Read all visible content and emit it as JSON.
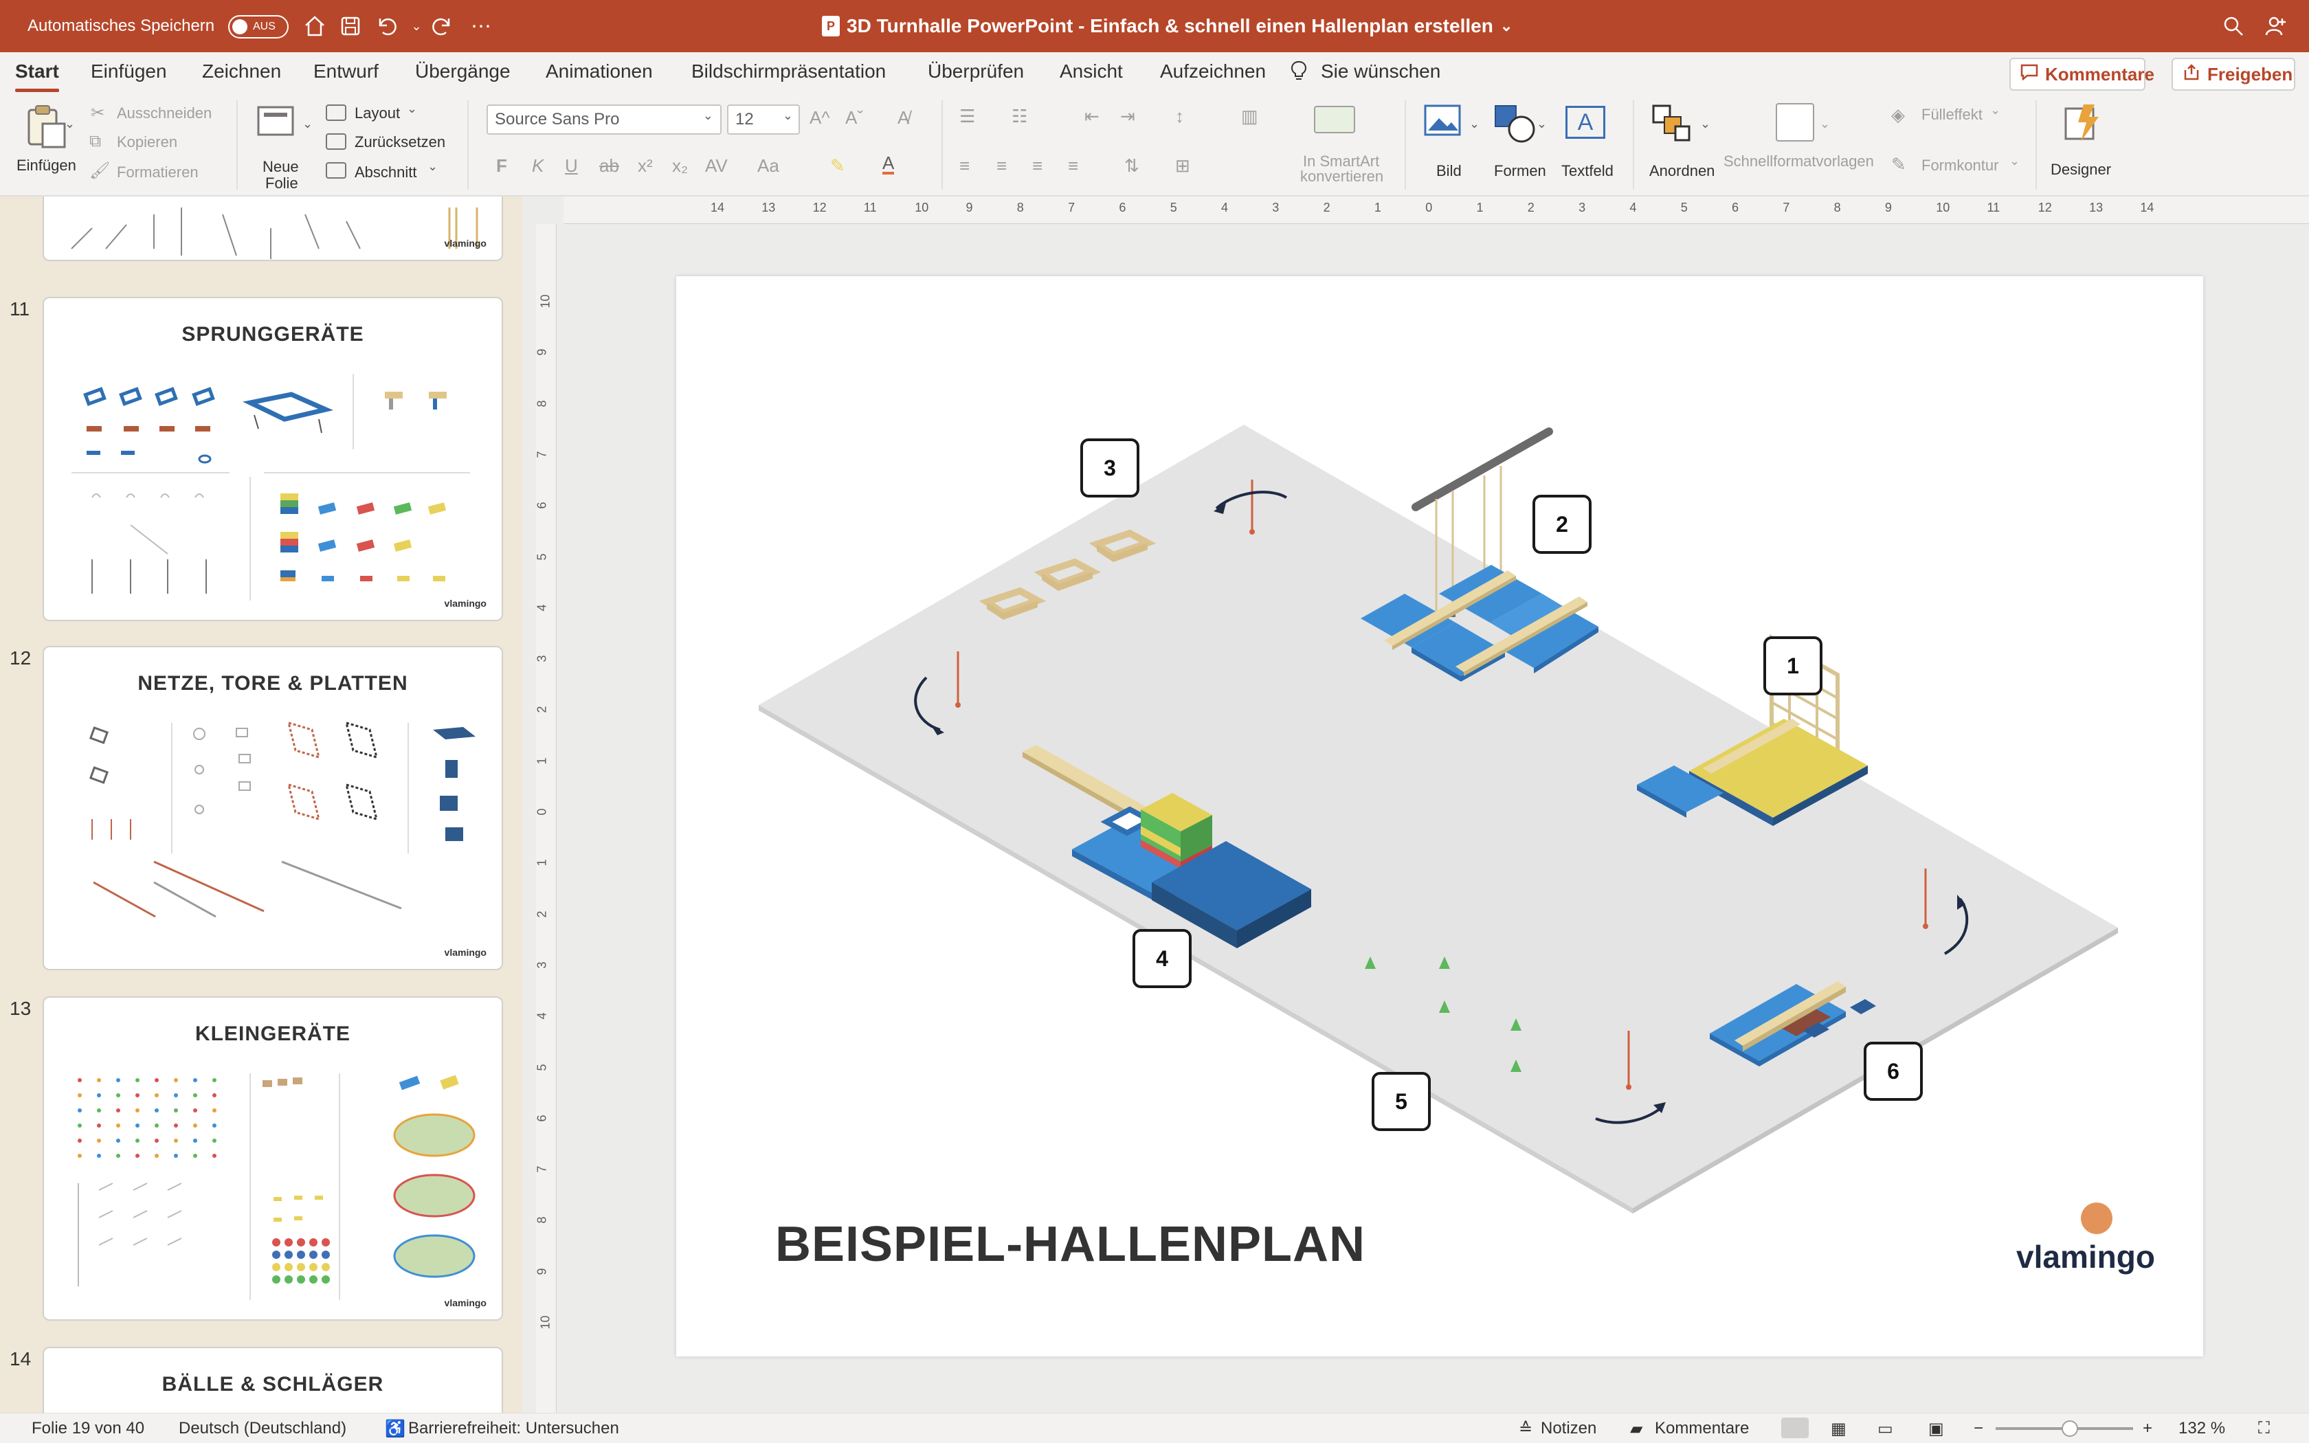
{
  "titlebar": {
    "autosave_label": "Automatisches Speichern",
    "autosave_state": "AUS",
    "doc_title": "3D Turnhalle PowerPoint - Einfach & schnell einen Hallenplan erstellen",
    "ppt_icon_letter": "P",
    "icons": [
      "home-icon",
      "save-icon",
      "undo-icon",
      "redo-icon",
      "more-icon",
      "search-icon",
      "share-people-icon"
    ]
  },
  "menu": {
    "tabs": [
      "Start",
      "Einfügen",
      "Zeichnen",
      "Entwurf",
      "Übergänge",
      "Animationen",
      "Bildschirmpräsentation",
      "Überprüfen",
      "Ansicht",
      "Aufzeichnen"
    ],
    "tell_me": "Sie wünschen",
    "comments_btn": "Kommentare",
    "share_btn": "Freigeben"
  },
  "ribbon": {
    "paste": "Einfügen",
    "cut": "Ausschneiden",
    "copy": "Kopieren",
    "format": "Formatieren",
    "new_slide_1": "Neue",
    "new_slide_2": "Folie",
    "layout": "Layout",
    "reset": "Zurücksetzen",
    "section": "Abschnitt",
    "font_name": "Source Sans Pro",
    "font_size": "12",
    "smartart_1": "In SmartArt",
    "smartart_2": "konvertieren",
    "picture": "Bild",
    "shapes": "Formen",
    "textbox": "Textfeld",
    "arrange": "Anordnen",
    "quick_styles": "Schnellformatvorlagen",
    "fill_effect": "Fülleffekt",
    "shape_outline": "Formkontur",
    "designer": "Designer"
  },
  "thumbnails": [
    {
      "num": "11",
      "title": "SPRUNGGERÄTE",
      "logo": "vlamingo"
    },
    {
      "num": "12",
      "title": "NETZE, TORE & PLATTEN",
      "logo": "vlamingo"
    },
    {
      "num": "13",
      "title": "KLEINGERÄTE",
      "logo": "vlamingo"
    },
    {
      "num": "14",
      "title": "BÄLLE & SCHLÄGER"
    }
  ],
  "prev_thumb_logo": "vlamingo",
  "ruler": {
    "h": [
      "14",
      "13",
      "12",
      "11",
      "10",
      "9",
      "8",
      "7",
      "6",
      "5",
      "4",
      "3",
      "2",
      "1",
      "0",
      "1",
      "2",
      "3",
      "4",
      "5",
      "6",
      "7",
      "8",
      "9",
      "10",
      "11",
      "12",
      "13",
      "14"
    ],
    "v": [
      "10",
      "9",
      "8",
      "7",
      "6",
      "5",
      "4",
      "3",
      "2",
      "1",
      "0",
      "1",
      "2",
      "3",
      "4",
      "5",
      "6",
      "7",
      "8",
      "9",
      "10"
    ]
  },
  "slide": {
    "title": "BEISPIEL-HALLENPLAN",
    "logo": "vlamingo",
    "stations": [
      "1",
      "2",
      "3",
      "4",
      "5",
      "6"
    ]
  },
  "status": {
    "slide_of": "Folie 19 von 40",
    "language": "Deutsch (Deutschland)",
    "accessibility": "Barrierefreiheit: Untersuchen",
    "notes": "Notizen",
    "comments": "Kommentare",
    "zoom": "132 %"
  },
  "colors": {
    "brand": "#b7472a",
    "mat_blue": "#3f8fd6",
    "mat_yellow": "#e4d15a",
    "wood": "#e9d8a8",
    "floor": "#e4e4e4"
  }
}
